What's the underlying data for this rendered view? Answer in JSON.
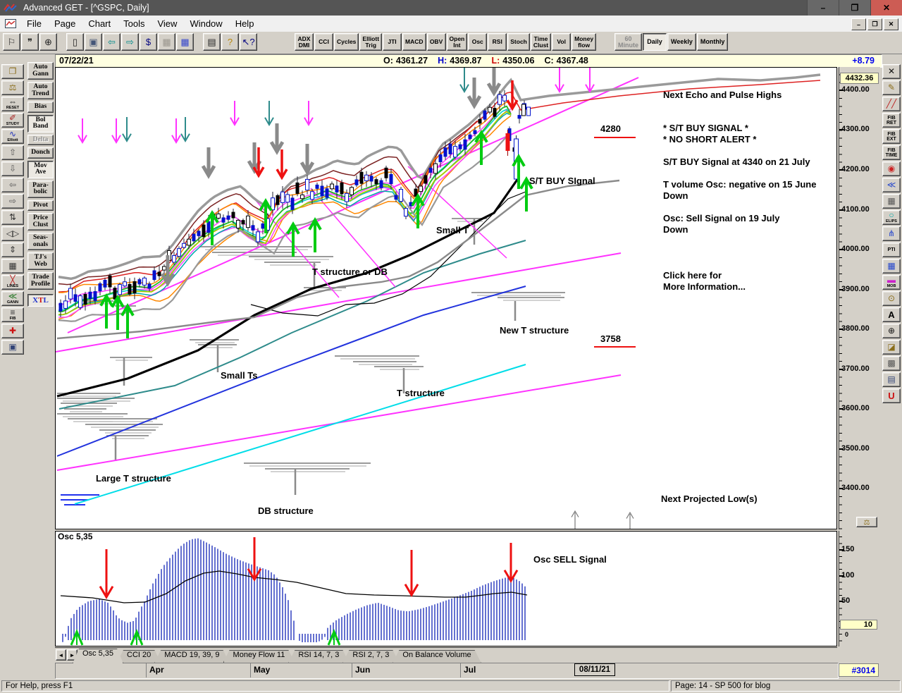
{
  "window": {
    "title": "Advanced GET - [^GSPC, Daily]",
    "controls": [
      {
        "name": "minimize-button",
        "glyph": "–"
      },
      {
        "name": "restore-button",
        "glyph": "❐"
      },
      {
        "name": "close-button",
        "glyph": "✕",
        "state": "close"
      }
    ]
  },
  "menu": {
    "items": [
      {
        "name": "menu-file",
        "label": "File"
      },
      {
        "name": "menu-page",
        "label": "Page"
      },
      {
        "name": "menu-chart",
        "label": "Chart"
      },
      {
        "name": "menu-tools",
        "label": "Tools"
      },
      {
        "name": "menu-view",
        "label": "View"
      },
      {
        "name": "menu-window",
        "label": "Window"
      },
      {
        "name": "menu-help",
        "label": "Help"
      }
    ],
    "mdi_controls": [
      {
        "name": "mdi-minimize-button",
        "glyph": "–"
      },
      {
        "name": "mdi-restore-button",
        "glyph": "❐"
      },
      {
        "name": "mdi-close-button",
        "glyph": "✕"
      }
    ]
  },
  "toolbar": {
    "file_tools": [
      {
        "name": "pin-icon",
        "glyph": "⚐",
        "color": "#222222"
      },
      {
        "name": "quotes-icon",
        "glyph": "❞",
        "color": "#222222"
      },
      {
        "name": "magnifier-icon",
        "glyph": "⊕",
        "color": "#222222"
      },
      {
        "name": "new-page-icon",
        "glyph": "▯",
        "color": "#222222"
      },
      {
        "name": "save-icon",
        "glyph": "▣",
        "color": "#445577"
      },
      {
        "name": "page-back-icon",
        "glyph": "⇦",
        "color": "#008b8b"
      },
      {
        "name": "page-forward-icon",
        "glyph": "⇨",
        "color": "#008b8b"
      },
      {
        "name": "chart-scale-icon",
        "glyph": "$",
        "color": "#000080"
      },
      {
        "name": "grid-off-icon",
        "glyph": "▦",
        "color": "#9a968e"
      },
      {
        "name": "grid-color-icon",
        "glyph": "▦",
        "color": "#3344cc"
      },
      {
        "name": "print-icon",
        "glyph": "▤",
        "color": "#222222"
      },
      {
        "name": "help-icon",
        "glyph": "?",
        "color": "#b8860b"
      },
      {
        "name": "context-help-icon",
        "glyph": "↖?",
        "color": "#000080"
      }
    ],
    "studies": [
      "ADX\nDMI",
      "CCI",
      "Cycles",
      "Elliott\nTrig",
      "JTI",
      "MACD",
      "OBV",
      "Open\nInt",
      "Osc",
      "RSI",
      "Stoch",
      "Time\nClust",
      "Vol",
      "Money\nflow"
    ],
    "timeframes": [
      {
        "label": "60\nMinute",
        "state": "disabled"
      },
      {
        "label": "Daily",
        "state": "pressed"
      },
      {
        "label": "Weekly",
        "state": ""
      },
      {
        "label": "Monthly",
        "state": ""
      }
    ]
  },
  "quote": {
    "date": "07/22/21",
    "fields": [
      {
        "label": "O:",
        "value": "4361.27",
        "color": "#000000"
      },
      {
        "label": "H:",
        "value": "4369.87",
        "color": "#0000cc"
      },
      {
        "label": "L:",
        "value": "4350.06",
        "color": "#cc0000"
      },
      {
        "label": "C:",
        "value": "4367.48",
        "color": "#000000"
      }
    ],
    "change": "+8.79"
  },
  "left_toolbox": {
    "tools": [
      {
        "name": "open-chart-icon",
        "glyph": "❐",
        "color": "#8a6d1a"
      },
      {
        "name": "scales-icon",
        "glyph": "⚖",
        "color": "#8a6d1a"
      },
      {
        "name": "reset-icon",
        "glyph": "⇔",
        "label": "RESET",
        "color": "#222222"
      },
      {
        "name": "study-icon",
        "glyph": "✐",
        "label": "STUDY",
        "color": "#aa2222"
      },
      {
        "name": "elliott-wave-icon",
        "glyph": "∿",
        "label": "Elliott",
        "color": "#2233bb"
      },
      {
        "name": "arrow-up-icon",
        "glyph": "⇧",
        "color": "#555555"
      },
      {
        "name": "arrow-down-icon",
        "glyph": "⇩",
        "color": "#555555"
      },
      {
        "name": "arrow-left-icon",
        "glyph": "⇦",
        "color": "#555555"
      },
      {
        "name": "arrow-right-icon",
        "glyph": "⇨",
        "color": "#555555"
      },
      {
        "name": "compress-vertical-icon",
        "glyph": "⇅",
        "color": "#333333"
      },
      {
        "name": "expand-horizontal-icon",
        "glyph": "◁▷",
        "color": "#333333"
      },
      {
        "name": "compress-time-icon",
        "glyph": "⇕",
        "color": "#333333"
      },
      {
        "name": "grid-dots-icon",
        "glyph": "▦",
        "color": "#333333"
      },
      {
        "name": "lines-tool-icon",
        "glyph": "╳",
        "label": "LINES",
        "color": "#bb2222"
      },
      {
        "name": "gann-tool-icon",
        "glyph": "≪",
        "label": "GANN",
        "color": "#227722"
      },
      {
        "name": "fib-tool-icon",
        "glyph": "≡",
        "label": "FIB",
        "color": "#333333"
      },
      {
        "name": "crosshair-icon",
        "glyph": "✚",
        "color": "#cc1111"
      },
      {
        "name": "snapshot-icon",
        "glyph": "▣",
        "color": "#334477"
      }
    ],
    "studies": [
      {
        "label": "Auto\nGann",
        "state": ""
      },
      {
        "label": "Auto\nTrend",
        "state": ""
      },
      {
        "label": "Bias",
        "state": ""
      },
      {
        "label": "Bol\nBand",
        "state": "pressed"
      },
      {
        "label": "Delta",
        "state": "disabled"
      },
      {
        "label": "Donch",
        "state": ""
      },
      {
        "label": "Mov\nAve",
        "state": "pressed"
      },
      {
        "label": "Para-\nbolic",
        "state": ""
      },
      {
        "label": "Pivot",
        "state": ""
      },
      {
        "label": "Price\nClust",
        "state": ""
      },
      {
        "label": "Seas-\nonals",
        "state": ""
      },
      {
        "label": "TJ's\nWeb",
        "state": ""
      },
      {
        "label": "Trade\nProfile",
        "state": ""
      }
    ],
    "xtl": {
      "x": "X",
      "t": "T",
      "l": "L"
    }
  },
  "right_toolbox": {
    "tools": [
      {
        "name": "close-chart-icon",
        "glyph": "✕",
        "color": "#111111"
      },
      {
        "name": "pencil-icon",
        "glyph": "✎",
        "color": "#8a6d1a"
      },
      {
        "name": "trendlines-icon",
        "glyph": "╱╱",
        "color": "#bb2222"
      },
      {
        "name": "fib-retracement-icon",
        "glyph": "FIB\nRET",
        "state": "text"
      },
      {
        "name": "fib-extension-icon",
        "glyph": "FIB\nEXT",
        "state": "text"
      },
      {
        "name": "fib-time-icon",
        "glyph": "FIB\nTIME",
        "state": "text"
      },
      {
        "name": "fib-circles-icon",
        "glyph": "◉",
        "color": "#cc2222"
      },
      {
        "name": "fan-lines-icon",
        "glyph": "≪",
        "color": "#2244cc"
      },
      {
        "name": "grid-tool-icon",
        "glyph": "▦",
        "color": "#555555"
      },
      {
        "name": "ellipse-tool-icon",
        "glyph": "○",
        "label": "ELIPS",
        "color": "#00aaaa"
      },
      {
        "name": "pitchfork-icon",
        "glyph": "⋔",
        "color": "#2244cc"
      },
      {
        "name": "pti-icon",
        "glyph": "PTI",
        "state": "text"
      },
      {
        "name": "make-grid-icon",
        "glyph": "▦",
        "color": "#2244cc"
      },
      {
        "name": "mob-icon",
        "glyph": "▬",
        "label": "MOB",
        "color": "#cc22cc"
      },
      {
        "name": "profit-taking-icon",
        "glyph": "⊙",
        "color": "#8a6d1a"
      },
      {
        "name": "text-tool-icon",
        "glyph": "A",
        "state": "text-big"
      },
      {
        "name": "zoom-tool-icon",
        "glyph": "⊕",
        "color": "#111111"
      },
      {
        "name": "eraser-icon",
        "glyph": "◪",
        "color": "#8a6d1a"
      },
      {
        "name": "mosaic-icon",
        "glyph": "▩",
        "color": "#555555"
      },
      {
        "name": "notes-icon",
        "glyph": "▤",
        "color": "#334477"
      },
      {
        "name": "magnet-icon",
        "glyph": "U",
        "state": "text-big",
        "color": "#cc1111"
      }
    ]
  },
  "price_axis": {
    "current": "4432.36",
    "ticks": [
      "4400.00",
      "4300.00",
      "4200.00",
      "4100.00",
      "4000.00",
      "3900.00",
      "3800.00",
      "3700.00",
      "3600.00",
      "3500.00",
      "3400.00"
    ],
    "scales_button": "⚖"
  },
  "osc_axis": {
    "ticks": [
      "150",
      "100",
      "50"
    ],
    "current": "10",
    "zero": "0"
  },
  "chart": {
    "annotations": {
      "next_echo": "Next Echo and Pulse Highs",
      "level_4280": "4280",
      "buy_signal_1": "* S/T BUY SIGNAL *",
      "buy_signal_2": "* NO SHORT ALERT *",
      "st_buy_4340": "S/T BUY Signal at 4340 on 21 July",
      "t_volume_1": "T volume Osc: negative on 15 June",
      "t_volume_2": "Down",
      "osc_sell_1": "Osc: Sell Signal on 19 July",
      "osc_sell_2": "Down",
      "click_here_1": "Click here for",
      "click_here_2": "More Information...",
      "st_buy_label": "S/T BUY SIgnal",
      "small_t": "Small T",
      "t_structure_or_db": "T structure or DB",
      "new_t_structure": "New T structure",
      "level_3758": "3758",
      "small_ts": "Small Ts",
      "t_structure": "T structure",
      "large_t_structure": "Large T structure",
      "db_structure": "DB structure",
      "next_projected_lows": "Next Projected Low(s)"
    }
  },
  "oscillator": {
    "label": "Osc 5,35",
    "sell_signal": "Osc SELL Signal"
  },
  "tabs": {
    "scroll": [
      "◄",
      "►"
    ],
    "items": [
      {
        "name": "tab-osc-5-35",
        "label": "Osc 5,35",
        "state": "active"
      },
      {
        "name": "tab-cci-20",
        "label": "CCI 20",
        "state": ""
      },
      {
        "name": "tab-macd",
        "label": "MACD 19, 39, 9",
        "state": ""
      },
      {
        "name": "tab-money-flow",
        "label": "Money Flow 11",
        "state": ""
      },
      {
        "name": "tab-rsi-14-7-3",
        "label": "RSI 14, 7, 3",
        "state": ""
      },
      {
        "name": "tab-rsi-2-7-3",
        "label": "RSI 2, 7, 3",
        "state": ""
      },
      {
        "name": "tab-on-balance-volume",
        "label": "On Balance Volume",
        "state": ""
      }
    ]
  },
  "x_axis": {
    "months": [
      "Apr",
      "May",
      "Jun",
      "Jul"
    ],
    "date_box": "08/11/21",
    "bar_number": "#3014"
  },
  "status": {
    "help": "For Help, press F1",
    "page": "Page: 14 - SP 500 for blog"
  }
}
